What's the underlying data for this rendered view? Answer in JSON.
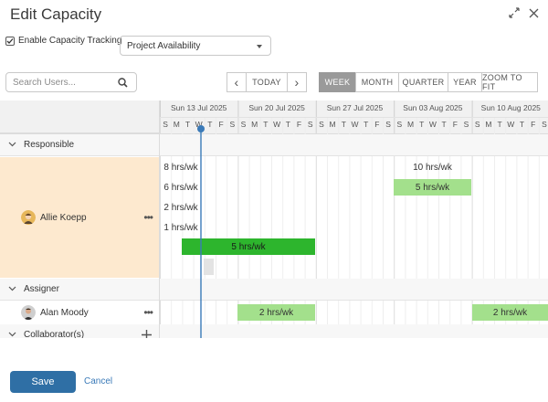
{
  "title": "Edit Capacity",
  "capacity": {
    "label": "Enable Capacity Tracking",
    "checked": true,
    "select_value": "Project Availability"
  },
  "search": {
    "placeholder": "Search Users..."
  },
  "nav": {
    "prev": "‹",
    "today": "TODAY",
    "next": "›"
  },
  "views": [
    "WEEK",
    "MONTH",
    "QUARTER",
    "YEAR",
    "ZOOM TO FIT"
  ],
  "active_view": "WEEK",
  "timeline": {
    "weeks": [
      "Sun 13 Jul 2025",
      "Sun 20 Jul 2025",
      "Sun 27 Jul 2025",
      "Sun 03 Aug 2025",
      "Sun 10 Aug 2025"
    ],
    "day_letters": [
      "S",
      "M",
      "T",
      "W",
      "T",
      "F",
      "S"
    ]
  },
  "groups": [
    {
      "name": "Responsible"
    },
    {
      "name": "Assigner"
    },
    {
      "name": "Collaborator(s)"
    }
  ],
  "users": {
    "responsible": {
      "name": "Allie Koepp",
      "more": "•••"
    },
    "assigner": {
      "name": "Alan Moody",
      "more": "•••"
    }
  },
  "bars": [
    {
      "label": "8 hrs/wk",
      "style": "gray"
    },
    {
      "label": "6 hrs/wk",
      "style": "gray"
    },
    {
      "label": "2 hrs/wk",
      "style": "gray"
    },
    {
      "label": "1 hrs/wk",
      "style": "gray"
    },
    {
      "label": "5 hrs/wk",
      "style": "dgreen"
    },
    {
      "label": "10 hrs/wk",
      "style": "gray"
    },
    {
      "label": "5 hrs/wk",
      "style": "lgreen"
    },
    {
      "label": "2 hrs/wk",
      "style": "lgreen"
    },
    {
      "label": "2 hrs/wk",
      "style": "lgreen"
    }
  ],
  "footer": {
    "save": "Save",
    "cancel": "Cancel"
  },
  "colors": {
    "accent": "#2f6fa5",
    "today_line": "#3a7ab8",
    "highlight_row": "#fde9cf",
    "dark_green": "#2db52d",
    "light_green": "#a3e08c"
  }
}
